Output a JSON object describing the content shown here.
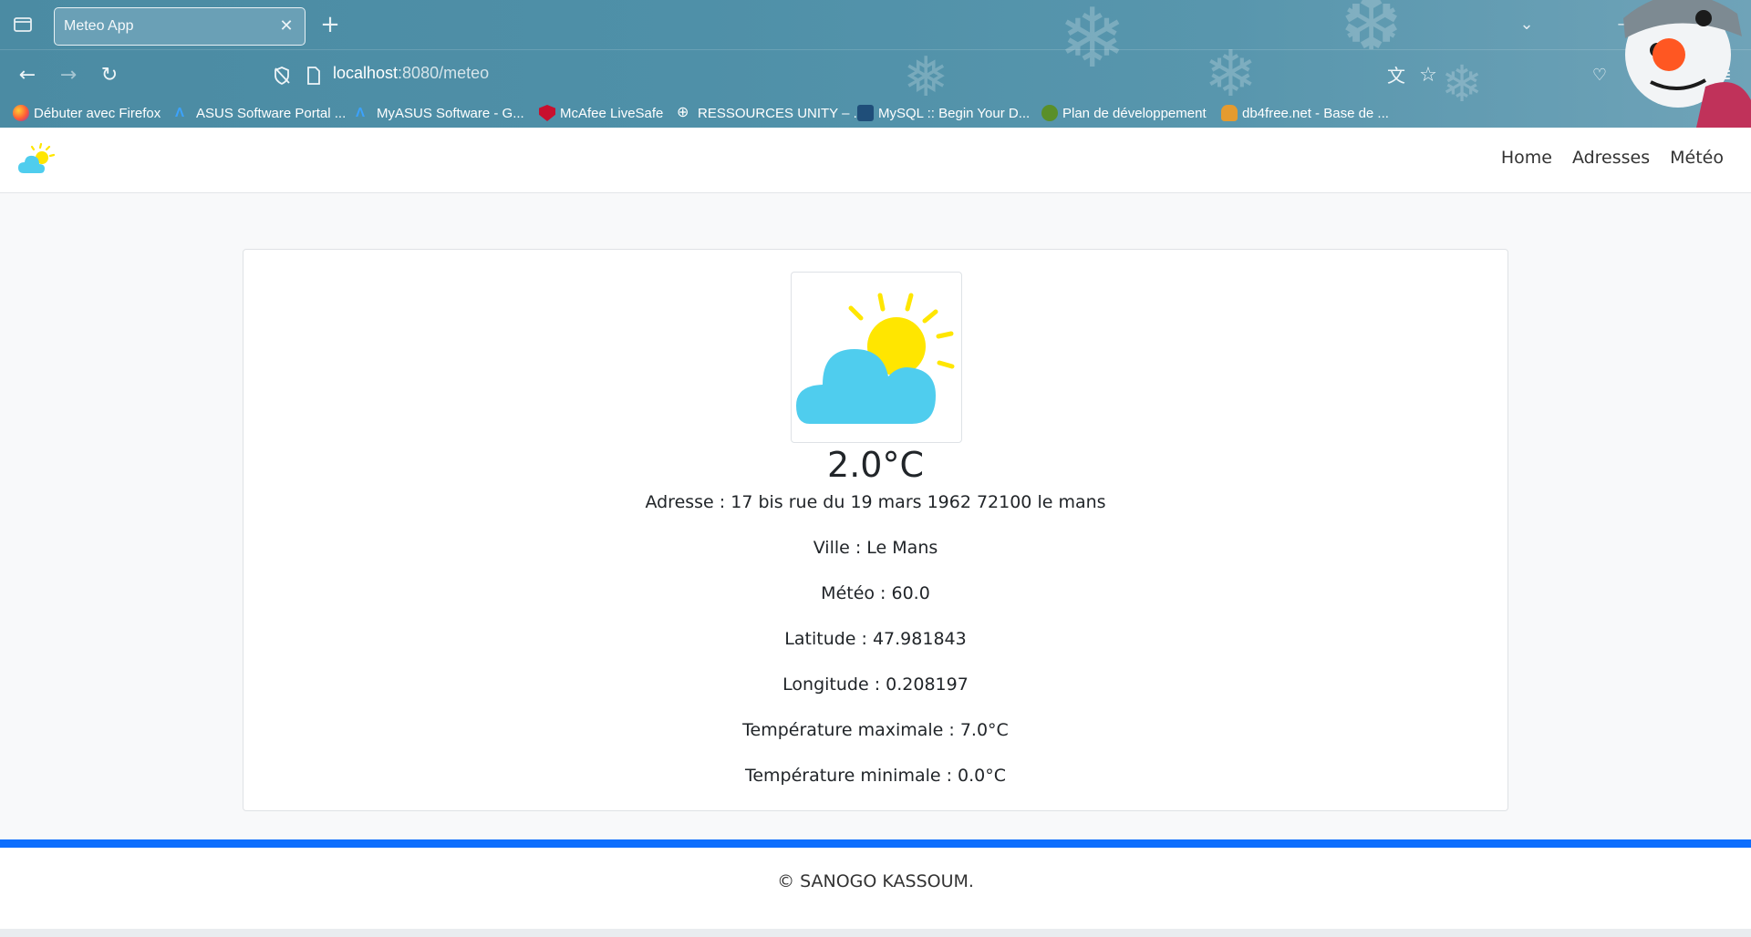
{
  "browser": {
    "tab_title": "Meteo App",
    "url_host": "localhost",
    "url_path": ":8080/meteo",
    "bookmarks": [
      {
        "label": "Débuter avec Firefox",
        "icon": "firefox-icon"
      },
      {
        "label": "ASUS Software Portal ...",
        "icon": "asus-icon"
      },
      {
        "label": "MyASUS Software - G...",
        "icon": "asus-icon"
      },
      {
        "label": "McAfee LiveSafe",
        "icon": "mcafee-icon"
      },
      {
        "label": "RESSOURCES UNITY – ...",
        "icon": "globe-icon"
      },
      {
        "label": "MySQL :: Begin Your D...",
        "icon": "mysql-icon"
      },
      {
        "label": "Plan de développement",
        "icon": "plan-icon"
      },
      {
        "label": "db4free.net - Base de ...",
        "icon": "db4free-icon"
      }
    ]
  },
  "site": {
    "nav": {
      "home": "Home",
      "addresses": "Adresses",
      "weather": "Météo"
    }
  },
  "weather": {
    "temperature": "2.0°C",
    "lines": [
      "Adresse : 17 bis rue du 19 mars 1962 72100 le mans",
      "Ville : Le Mans",
      "Météo : 60.0",
      "Latitude : 47.981843",
      "Longitude : 0.208197",
      "Température maximale : 7.0°C",
      "Température minimale : 0.0°C"
    ]
  },
  "footer": {
    "text": "© SANOGO KASSOUM."
  },
  "colors": {
    "accent": "#0d6efd",
    "sun": "#ffe600",
    "cloud": "#4fcdee"
  }
}
